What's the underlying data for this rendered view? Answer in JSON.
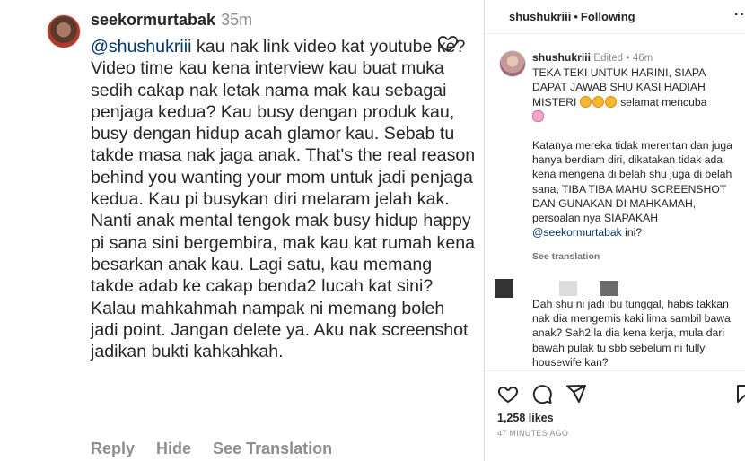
{
  "comment": {
    "username": "seekormurtabak",
    "time": "35m",
    "mention": "@shushukriii",
    "text": " kau nak link video kat youtube ke? Video time kau kena interview kau buat muka sedih cakap nak letak nama mak kau sebagai penjaga kedua? Kau busy dengan produk kau, busy dengan hidup acah glamor kau. Sebab tu takde masa nak jaga anak. That's the real reason behind you wanting your mom untuk jadi penjaga kedua. Kau pi busykan diri melaram jelah kak. Nanti anak mental tengok mak busy hidup happy pi sana sini bergembira, mak kau kat rumah kena besarkan anak kau. Lagi satu, kau memang takde adab ke cakap benda2 lucah kat sini? Kalau mahkahmah nampak ni memang boleh jadi point. Jangan delete ya. Aku nak screenshot jadikan bukti kahkahkah.",
    "actions": {
      "reply": "Reply",
      "hide": "Hide",
      "translate": "See Translation"
    },
    "like_icon": "heart-outline-icon"
  },
  "post": {
    "header": {
      "username": "shushukriii",
      "separator": "•",
      "follow": "Following",
      "more": "···"
    },
    "caption": {
      "username": "shushukriii",
      "edited": "Edited",
      "separator": "•",
      "time": "46m",
      "line1": "TEKA TEKI UNTUK HARINI, SIAPA DAPAT JAWAB SHU KASI HADIAH MISTERI",
      "line1_tail": " selamat mencuba",
      "para2": "Katanya mereka tidak merentan dan juga hanya berdiam diri, dikatakan tidak ada kena mengena di belah shu juga di belah sana, TIBA TIBA MAHU SCREENSHOT DAN GUNAKAN DI MAHKAMAH, persoalan nya SIAPAKAH ",
      "para2_mention": "@seekormurtabak",
      "para2_tail": " ini?",
      "see_translation": "See translation"
    },
    "comment_preview": "Dah shu ni jadi ibu tunggal, habis takkan nak dia mengemis kaki lima sambil bawa anak? Sah2 la dia kena kerja, mula dari bawah pulak tu sbb sebelum ni fully housewife kan?",
    "likes": "1,258 likes",
    "time_ago": "47 MINUTES AGO",
    "icons": [
      "heart-icon",
      "comment-icon",
      "share-icon",
      "bookmark-icon"
    ]
  }
}
